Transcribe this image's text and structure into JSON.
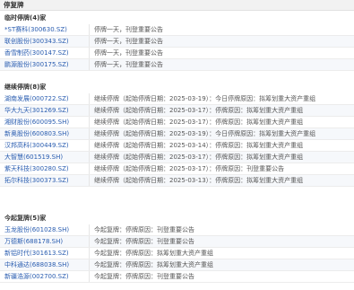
{
  "title": "停复牌",
  "sections": [
    {
      "title": "临时停牌(4)家",
      "rows": [
        {
          "name": "*ST赛科(300630.SZ)",
          "info": "停牌一天，刊登重要公告"
        },
        {
          "name": "联创股份(300343.SZ)",
          "info": "停牌一天，刊登重要公告"
        },
        {
          "name": "香雪制药(300147.SZ)",
          "info": "停牌一天，刊登重要公告"
        },
        {
          "name": "鹏源股份(300175.SZ)",
          "info": "停牌一天，刊登重要公告"
        }
      ]
    },
    {
      "title": "继续停牌(8)家",
      "rows": [
        {
          "name": "湖南发展(000722.SZ)",
          "info": "继续停牌（起始停牌日期：2025-03-19）：今日停牌原因：拟筹划重大资产重组"
        },
        {
          "name": "华大九天(301269.SZ)",
          "info": "继续停牌（起始停牌日期：2025-03-17）：停牌原因：拟筹划重大资产重组"
        },
        {
          "name": "湘财股份(600095.SH)",
          "info": "继续停牌（起始停牌日期：2025-03-17）：停牌原因：拟筹划重大资产重组"
        },
        {
          "name": "新奥股份(600803.SH)",
          "info": "继续停牌（起始停牌日期：2025-03-19）：今日停牌原因：拟筹划重大资产重组"
        },
        {
          "name": "汉邦高科(300449.SZ)",
          "info": "继续停牌（起始停牌日期：2025-03-14）：停牌原因：拟筹划重大资产重组"
        },
        {
          "name": "大智慧(601519.SH)",
          "info": "继续停牌（起始停牌日期：2025-03-17）：停牌原因：拟筹划重大资产重组"
        },
        {
          "name": "紫天科技(300280.SZ)",
          "info": "继续停牌（起始停牌日期：2025-03-17）：停牌原因：刊登重要公告"
        },
        {
          "name": "拓尔科技(300373.SZ)",
          "info": "继续停牌（起始停牌日期：2025-03-13）：停牌原因：拟筹划重大资产重组"
        }
      ]
    },
    {
      "title": "今起复牌(5)家",
      "rows": [
        {
          "name": "玉龙股份(601028.SH)",
          "info": "今起复牌：停牌原因：刊登重要公告"
        },
        {
          "name": "万德斯(688178.SH)",
          "info": "今起复牌：停牌原因：刊登重要公告"
        },
        {
          "name": "新铝时代(301613.SZ)",
          "info": "今起复牌：停牌原因：拟筹划重大资产重组"
        },
        {
          "name": "中科通达(688038.SH)",
          "info": "今起复牌：停牌原因：拟筹划重大资产重组"
        },
        {
          "name": "新疆浩源(002700.SZ)",
          "info": "今起复牌：停牌原因：刊登重要公告"
        }
      ]
    }
  ]
}
